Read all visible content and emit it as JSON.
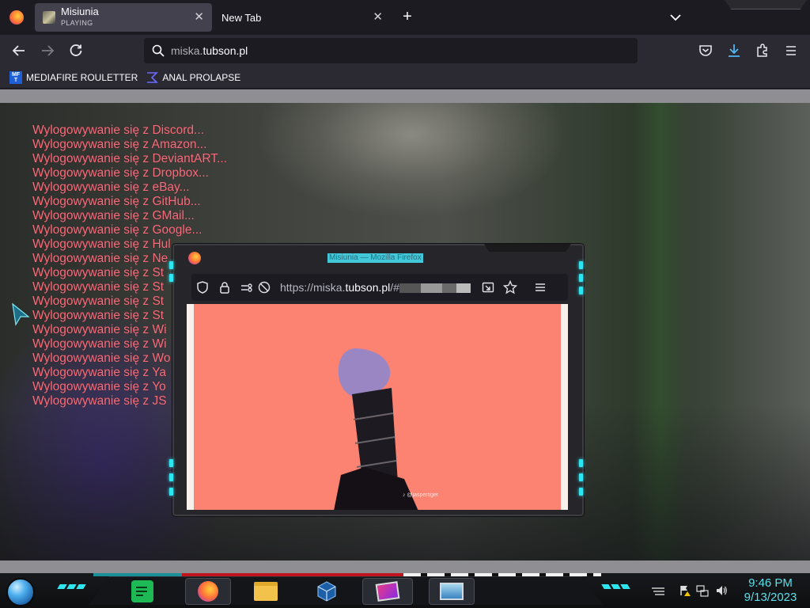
{
  "browser": {
    "tabs": [
      {
        "title": "Misiunia",
        "subtitle": "PLAYING",
        "active": true
      },
      {
        "title": "New Tab",
        "active": false
      }
    ],
    "new_tab_symbol": "+",
    "tab_list_symbol": "⌄",
    "close_symbol": "✕",
    "url": {
      "host_prefix": "miska.",
      "host_main": "tubson.pl"
    },
    "bookmarks": [
      {
        "label": "MEDIAFIRE ROULETTER",
        "icon": "mediafire-icon"
      },
      {
        "label": "ANAL PROLAPSE",
        "icon": "sigma-icon"
      }
    ]
  },
  "page": {
    "logout_lines": [
      "Wylogowywanie się z Discord...",
      "Wylogowywanie się z Amazon...",
      "Wylogowywanie się z DeviantART...",
      "Wylogowywanie się z Dropbox...",
      "Wylogowywanie się z eBay...",
      "Wylogowywanie się z GitHub...",
      "Wylogowywanie się z GMail...",
      "Wylogowywanie się z Google...",
      "Wylogowywanie się z Hul",
      "Wylogowywanie się z Ne",
      "Wylogowywanie się z St",
      "Wylogowywanie się z St",
      "Wylogowywanie się z St",
      "Wylogowywanie się z St",
      "Wylogowywanie się z Wi",
      "Wylogowywanie się z Wi",
      "Wylogowywanie się z Wo",
      "Wylogowywanie się z Ya",
      "Wylogowywanie się z Yo",
      "Wylogowywanie się z JS"
    ]
  },
  "popup": {
    "window_title": "Misiunia — Mozilla Firefox",
    "url_prefix": "https://miska.",
    "url_main": "tubson.pl",
    "url_suffix": "/#",
    "video_watermark": "♪ @jaspertiger"
  },
  "taskbar": {
    "time": "9:46 PM",
    "date": "9/13/2023",
    "apps": [
      "notes-app-icon",
      "firefox-icon",
      "file-explorer-icon",
      "virtualbox-icon",
      "image-app-icon",
      "window-app-icon"
    ]
  },
  "colors": {
    "accent_cyan": "#2fe6f0",
    "logout_text": "#f0707c",
    "video_bg": "#fc8272",
    "browser_bg": "#2b2a33",
    "tabbar_bg": "#1c1b22"
  }
}
